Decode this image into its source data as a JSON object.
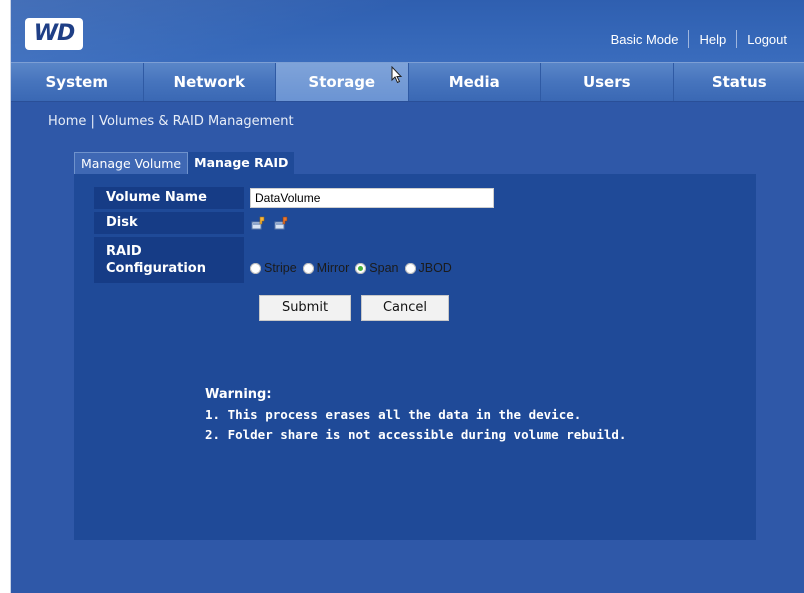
{
  "header": {
    "logo_text": "WD",
    "links": [
      "Basic Mode",
      "Help",
      "Logout"
    ]
  },
  "nav": {
    "tabs": [
      "System",
      "Network",
      "Storage",
      "Media",
      "Users",
      "Status"
    ],
    "active": "Storage"
  },
  "breadcrumb": {
    "home": "Home",
    "separator": "|",
    "current": "Volumes & RAID Management"
  },
  "subtabs": {
    "manage_volume": "Manage Volume",
    "manage_raid": "Manage RAID"
  },
  "form": {
    "volume_name_label": "Volume Name",
    "volume_name_value": "DataVolume",
    "disk_label": "Disk",
    "raid_label_line1": "RAID",
    "raid_label_line2": "Configuration",
    "raid_options": [
      "Stripe",
      "Mirror",
      "Span",
      "JBOD"
    ],
    "raid_selected": "Span"
  },
  "buttons": {
    "submit": "Submit",
    "cancel": "Cancel"
  },
  "warning": {
    "title": "Warning:",
    "line1": "1. This process erases all the data in the device.",
    "line2": "2. Folder share is not accessible during volume rebuild."
  },
  "colors": {
    "background": "#2f58a8",
    "panel": "#1f4a98",
    "label_cell": "#163c86",
    "radio_checked": "#47b23a"
  }
}
